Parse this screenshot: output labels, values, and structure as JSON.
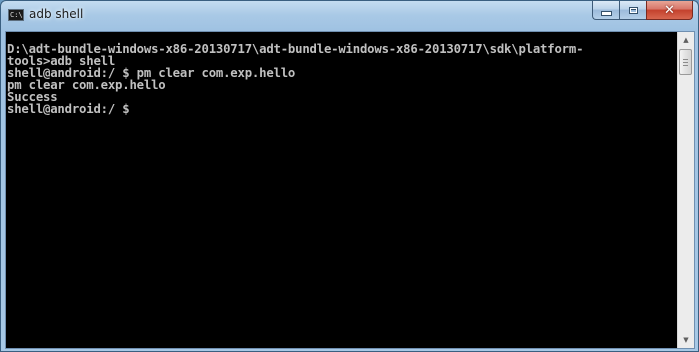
{
  "window": {
    "title": "adb shell",
    "icon": "cmd-icon",
    "icon_glyph": "C:\\",
    "controls": {
      "minimize": "minimize-icon",
      "maximize": "maximize-icon",
      "close": "close-icon",
      "close_glyph": "✕"
    }
  },
  "console": {
    "lines": [
      "D:\\adt-bundle-windows-x86-20130717\\adt-bundle-windows-x86-20130717\\sdk\\platform-",
      "tools>adb shell",
      "shell@android:/ $ pm clear com.exp.hello",
      "pm clear com.exp.hello",
      "Success",
      "shell@android:/ $ "
    ],
    "text_color": "#c0c0c0",
    "background": "#000000"
  },
  "scrollbar": {
    "up_glyph": "▲",
    "down_glyph": "▼"
  }
}
